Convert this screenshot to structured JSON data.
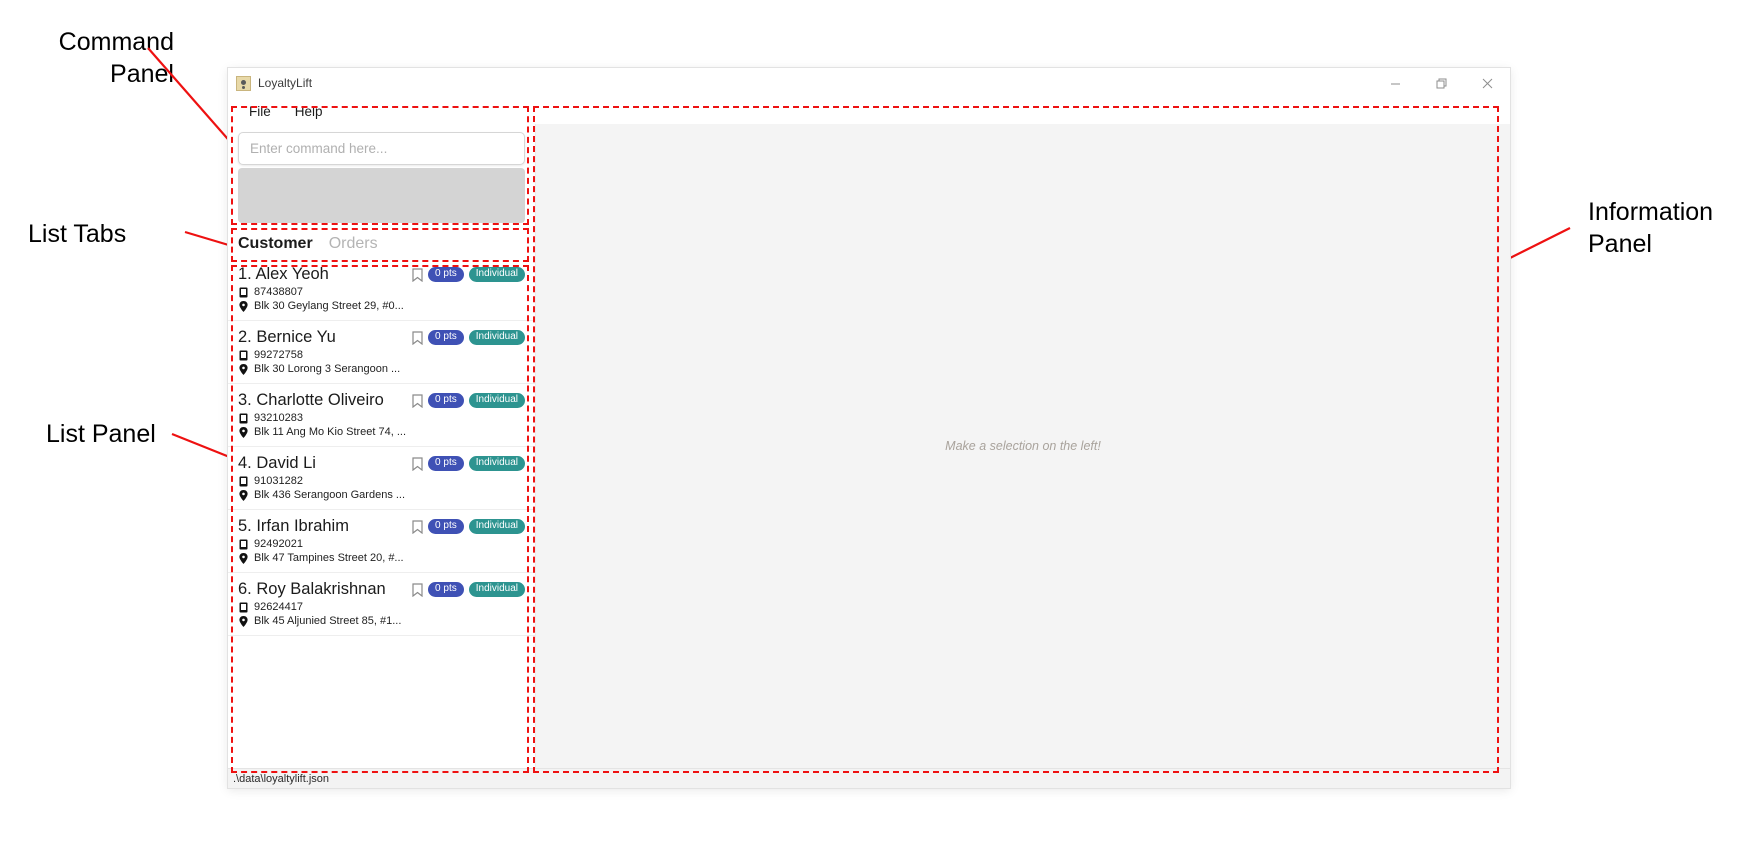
{
  "annotations": [
    {
      "id": "command-panel",
      "label": "Command\nPanel"
    },
    {
      "id": "list-tabs",
      "label": "List Tabs"
    },
    {
      "id": "list-panel",
      "label": "List Panel"
    },
    {
      "id": "information-panel",
      "label": "Information\nPanel"
    }
  ],
  "window": {
    "title": "LoyaltyLift",
    "app_icon": "person-card-icon",
    "controls": {
      "minimize": "minimize-icon",
      "maximize": "restore-icon",
      "close": "close-icon"
    }
  },
  "menu": {
    "items": [
      {
        "label": "File"
      },
      {
        "label": "Help"
      }
    ]
  },
  "command_panel": {
    "input_value": "",
    "placeholder": "Enter command here...",
    "result_text": ""
  },
  "list_tabs": {
    "tabs": [
      {
        "label": "Customer",
        "active": true
      },
      {
        "label": "Orders",
        "active": false
      }
    ]
  },
  "list_panel": {
    "items": [
      {
        "index": "1.",
        "name": "Alex Yeoh",
        "phone": "87438807",
        "address": "Blk 30 Geylang Street 29, #0...",
        "points_badge": "0 pts",
        "tier_badge": "Individual",
        "bookmark": "bookmark-icon"
      },
      {
        "index": "2.",
        "name": "Bernice Yu",
        "phone": "99272758",
        "address": "Blk 30 Lorong 3 Serangoon ...",
        "points_badge": "0 pts",
        "tier_badge": "Individual",
        "bookmark": "bookmark-icon"
      },
      {
        "index": "3.",
        "name": "Charlotte Oliveiro",
        "phone": "93210283",
        "address": "Blk 11 Ang Mo Kio Street 74, ...",
        "points_badge": "0 pts",
        "tier_badge": "Individual",
        "bookmark": "bookmark-icon"
      },
      {
        "index": "4.",
        "name": "David Li",
        "phone": "91031282",
        "address": "Blk 436 Serangoon Gardens ...",
        "points_badge": "0 pts",
        "tier_badge": "Individual",
        "bookmark": "bookmark-icon"
      },
      {
        "index": "5.",
        "name": "Irfan Ibrahim",
        "phone": "92492021",
        "address": "Blk 47 Tampines Street 20, #...",
        "points_badge": "0 pts",
        "tier_badge": "Individual",
        "bookmark": "bookmark-icon"
      },
      {
        "index": "6.",
        "name": "Roy Balakrishnan",
        "phone": "92624417",
        "address": "Blk 45 Aljunied Street 85, #1...",
        "points_badge": "0 pts",
        "tier_badge": "Individual",
        "bookmark": "bookmark-icon"
      }
    ]
  },
  "info_panel": {
    "placeholder": "Make a selection on the left!"
  },
  "status_bar": {
    "path": ".\\data\\loyaltylift.json"
  },
  "colors": {
    "annotation": "#ee1111",
    "badge_points": "#3f51b5",
    "badge_tier": "#2d9490",
    "info_panel_bg": "#f4f4f4",
    "result_display_bg": "#d4d4d4"
  }
}
